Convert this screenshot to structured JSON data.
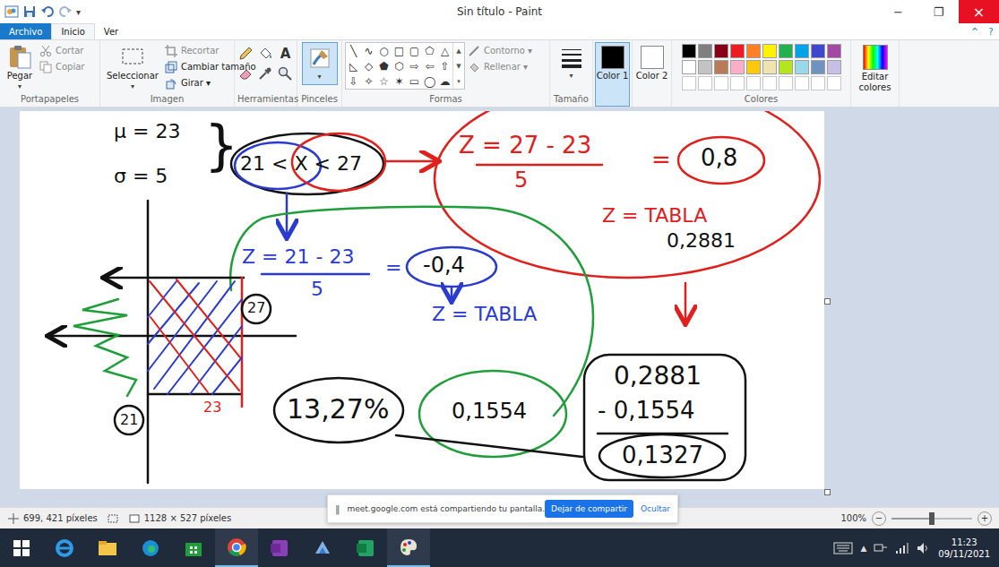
{
  "window": {
    "title": "Sin título - Paint",
    "quick_access_caret": "▾",
    "buttons": [
      "−",
      "❐",
      "×"
    ]
  },
  "tabs": [
    {
      "label": "Archivo",
      "selected": false,
      "kind": "file"
    },
    {
      "label": "Inicio",
      "selected": true,
      "kind": "tab"
    },
    {
      "label": "Ver",
      "selected": false,
      "kind": "tab"
    }
  ],
  "ribbon_controls": [
    "^",
    "?"
  ],
  "clipboard": {
    "label": "Portapapeles",
    "paste": "Pegar",
    "paste_caret": "▾",
    "cut": "Cortar",
    "copy": "Copiar"
  },
  "image": {
    "label": "Imagen",
    "select": "Seleccionar",
    "select_caret": "▾",
    "crop": "Recortar",
    "resize": "Cambiar tamaño",
    "rotate": "Girar ▾"
  },
  "tools": {
    "label": "Herramientas",
    "text_tool": "A"
  },
  "brushes": {
    "label": "Pinceles",
    "caret": "▾",
    "selected": true
  },
  "shapes": {
    "label": "Formas",
    "gallery": [
      "╲",
      "∿",
      "○",
      "□",
      "▢",
      "⬠",
      "△",
      "◺",
      "◇",
      "⬟",
      "⬡",
      "⇨",
      "⇦",
      "⇧",
      "⇩",
      "✧",
      "☆",
      "✶",
      "▭",
      "◯",
      "☁"
    ],
    "gallery_scroll": [
      "▲",
      "▼",
      "▾"
    ],
    "outline": "Contorno ▾",
    "fill": "Rellenar ▾"
  },
  "size": {
    "label": "Tamaño",
    "caret": "▾"
  },
  "color_slots": [
    {
      "label": "Color 1",
      "color": "#000000",
      "selected": true
    },
    {
      "label": "Color 2",
      "color": "#ffffff",
      "selected": false
    }
  ],
  "colors": {
    "label": "Colores",
    "swatches": [
      {
        "color": "#000000",
        "empty": false
      },
      {
        "color": "#7f7f7f",
        "empty": false
      },
      {
        "color": "#880015",
        "empty": false
      },
      {
        "color": "#ed1c24",
        "empty": false
      },
      {
        "color": "#ff7f27",
        "empty": false
      },
      {
        "color": "#fff200",
        "empty": false
      },
      {
        "color": "#22b14c",
        "empty": false
      },
      {
        "color": "#00a2e8",
        "empty": false
      },
      {
        "color": "#3f48cc",
        "empty": false
      },
      {
        "color": "#a349a4",
        "empty": false
      },
      {
        "color": "#ffffff",
        "empty": false
      },
      {
        "color": "#c3c3c3",
        "empty": false
      },
      {
        "color": "#b97a57",
        "empty": false
      },
      {
        "color": "#ffaec9",
        "empty": false
      },
      {
        "color": "#ffc90e",
        "empty": false
      },
      {
        "color": "#efe4b0",
        "empty": false
      },
      {
        "color": "#b5e61d",
        "empty": false
      },
      {
        "color": "#99d9ea",
        "empty": false
      },
      {
        "color": "#7092be",
        "empty": false
      },
      {
        "color": "#c8bfe7",
        "empty": false
      },
      {
        "color": "#ffffff",
        "empty": true
      },
      {
        "color": "#ffffff",
        "empty": true
      },
      {
        "color": "#ffffff",
        "empty": true
      },
      {
        "color": "#ffffff",
        "empty": true
      },
      {
        "color": "#ffffff",
        "empty": true
      },
      {
        "color": "#ffffff",
        "empty": true
      },
      {
        "color": "#ffffff",
        "empty": true
      },
      {
        "color": "#ffffff",
        "empty": true
      },
      {
        "color": "#ffffff",
        "empty": true
      },
      {
        "color": "#ffffff",
        "empty": true
      }
    ]
  },
  "edit_colors": {
    "label": "Editar colores"
  },
  "canvas": {
    "notes": [
      {
        "text": "μ = 23",
        "color": "#111111"
      },
      {
        "text": "σ = 5",
        "color": "#111111"
      },
      {
        "text": "}",
        "color": "#111111"
      },
      {
        "text": "21 < X < 27",
        "color": "#111111"
      },
      {
        "text": "Z = 27 - 23",
        "color": "#e0201c"
      },
      {
        "text": "5",
        "color": "#e0201c"
      },
      {
        "text": "=",
        "color": "#e0201c"
      },
      {
        "text": "0,8",
        "color": "#111111"
      },
      {
        "text": "Z = TABLA",
        "color": "#e0201c"
      },
      {
        "text": "0,2881",
        "color": "#111111"
      },
      {
        "text": "Z = 21 - 23",
        "color": "#2a3bd0"
      },
      {
        "text": "5",
        "color": "#2a3bd0"
      },
      {
        "text": "=",
        "color": "#2a3bd0"
      },
      {
        "text": "-0,4",
        "color": "#111111"
      },
      {
        "text": "Z = TABLA",
        "color": "#2a3bd0"
      },
      {
        "text": "13,27%",
        "color": "#111111"
      },
      {
        "text": "0,1554",
        "color": "#111111"
      },
      {
        "text": "0,2881",
        "color": "#111111"
      },
      {
        "text": "- 0,1554",
        "color": "#111111"
      },
      {
        "text": "0,1327",
        "color": "#111111"
      },
      {
        "text": "21",
        "color": "#111111"
      },
      {
        "text": "27",
        "color": "#111111"
      },
      {
        "text": "23",
        "color": "#e0201c"
      }
    ]
  },
  "status_bar": {
    "cursor": "699, 421 píxeles",
    "canvas_size": "1128 × 527 píxeles",
    "zoom": "100%",
    "zoom_out": "−",
    "zoom_in": "+",
    "zoom_level": 0.5
  },
  "share_bar": {
    "icon": "‖",
    "message": "meet.google.com está compartiendo tu pantalla.",
    "stop": "Dejar de compartir",
    "hide": "Ocultar"
  },
  "taskbar": {
    "tray_caret": "▲",
    "time": "11:23",
    "date": "09/11/2021"
  }
}
